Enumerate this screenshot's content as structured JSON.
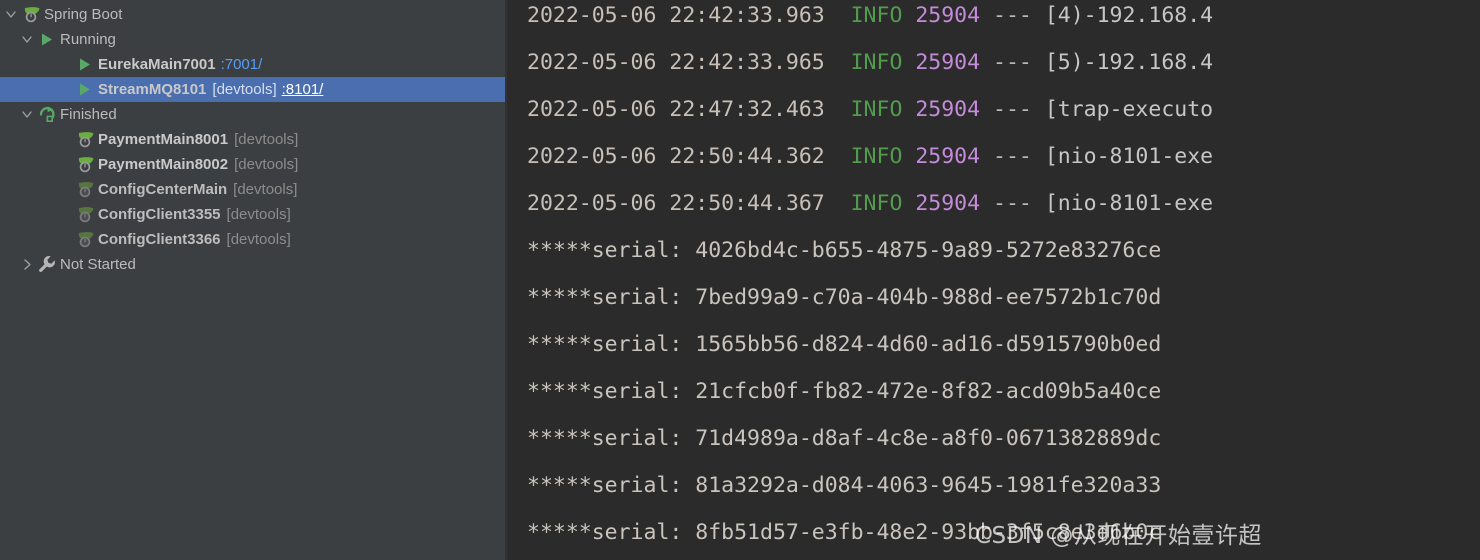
{
  "sidebar": {
    "title": "Spring Boot",
    "tree": [
      {
        "label": "Spring Boot",
        "icon": "spring-boot-icon",
        "twisty": "chevron-down-icon",
        "depth": 0,
        "kind": "root",
        "selected": false
      },
      {
        "label": "Running",
        "icon": "run-green-triangle-icon",
        "twisty": "chevron-down-icon",
        "depth": 1,
        "kind": "group",
        "selected": false
      },
      {
        "label": "EurekaMain7001",
        "icon": "run-green-triangle-icon",
        "twisty": "none",
        "depth": 2,
        "kind": "app",
        "devtools": "",
        "port": ":7001/",
        "selected": false
      },
      {
        "label": "StreamMQ8101",
        "icon": "run-green-triangle-icon",
        "twisty": "none",
        "depth": 2,
        "kind": "app",
        "devtools": "[devtools]",
        "port": ":8101/",
        "selected": true
      },
      {
        "label": "Finished",
        "icon": "rerun-green-arrow-icon",
        "twisty": "chevron-down-icon",
        "depth": 1,
        "kind": "group",
        "selected": false
      },
      {
        "label": "PaymentMain8001",
        "icon": "spring-boot-icon",
        "twisty": "none",
        "depth": 3,
        "kind": "app",
        "devtools": "[devtools]",
        "port": "",
        "dim": false,
        "selected": false
      },
      {
        "label": "PaymentMain8002",
        "icon": "spring-boot-icon",
        "twisty": "none",
        "depth": 3,
        "kind": "app",
        "devtools": "[devtools]",
        "port": "",
        "dim": false,
        "selected": false
      },
      {
        "label": "ConfigCenterMain",
        "icon": "spring-boot-icon",
        "twisty": "none",
        "depth": 3,
        "kind": "app",
        "devtools": "[devtools]",
        "port": "",
        "dim": true,
        "selected": false
      },
      {
        "label": "ConfigClient3355",
        "icon": "spring-boot-icon",
        "twisty": "none",
        "depth": 3,
        "kind": "app",
        "devtools": "[devtools]",
        "port": "",
        "dim": true,
        "selected": false
      },
      {
        "label": "ConfigClient3366",
        "icon": "spring-boot-icon",
        "twisty": "none",
        "depth": 3,
        "kind": "app",
        "devtools": "[devtools]",
        "port": "",
        "dim": true,
        "selected": false
      },
      {
        "label": "Not Started",
        "icon": "wrench-icon",
        "twisty": "chevron-right-icon",
        "depth": 1,
        "kind": "group",
        "selected": false
      }
    ]
  },
  "console": {
    "lines": [
      {
        "type": "log",
        "timestamp": "2022-05-06 22:42:33.963",
        "level": "INFO",
        "pid": "25904",
        "sep": "---",
        "thread": "[4)-192.168.4"
      },
      {
        "type": "log",
        "timestamp": "2022-05-06 22:42:33.965",
        "level": "INFO",
        "pid": "25904",
        "sep": "---",
        "thread": "[5)-192.168.4"
      },
      {
        "type": "log",
        "timestamp": "2022-05-06 22:47:32.463",
        "level": "INFO",
        "pid": "25904",
        "sep": "---",
        "thread": "[trap-executo"
      },
      {
        "type": "log",
        "timestamp": "2022-05-06 22:50:44.362",
        "level": "INFO",
        "pid": "25904",
        "sep": "---",
        "thread": "[nio-8101-exe"
      },
      {
        "type": "log",
        "timestamp": "2022-05-06 22:50:44.367",
        "level": "INFO",
        "pid": "25904",
        "sep": "---",
        "thread": "[nio-8101-exe"
      },
      {
        "type": "serial",
        "text": "*****serial: 4026bd4c-b655-4875-9a89-5272e83276ce"
      },
      {
        "type": "serial",
        "text": "*****serial: 7bed99a9-c70a-404b-988d-ee7572b1c70d"
      },
      {
        "type": "serial",
        "text": "*****serial: 1565bb56-d824-4d60-ad16-d5915790b0ed"
      },
      {
        "type": "serial",
        "text": "*****serial: 21cfcb0f-fb82-472e-8f82-acd09b5a40ce"
      },
      {
        "type": "serial",
        "text": "*****serial: 71d4989a-d8af-4c8e-a8f0-0671382889dc"
      },
      {
        "type": "serial",
        "text": "*****serial: 81a3292a-d084-4063-9645-1981fe320a33"
      },
      {
        "type": "serial",
        "text": "*****serial: 8fb51d57-e3fb-48e2-93bb-3f5c8e3d6b0c"
      }
    ]
  },
  "watermark": {
    "text": "CSDN @从现在开始壹许超"
  },
  "colors": {
    "sidebar_bg": "#3c3f41",
    "console_bg": "#2b2b2b",
    "selection": "#4b6eaf",
    "level_info": "#529c4e",
    "pid": "#c58bdb",
    "link": "#589df6",
    "text": "#c6c6c6",
    "muted": "#8c8c8c",
    "spring_green": "#6cad3f"
  }
}
